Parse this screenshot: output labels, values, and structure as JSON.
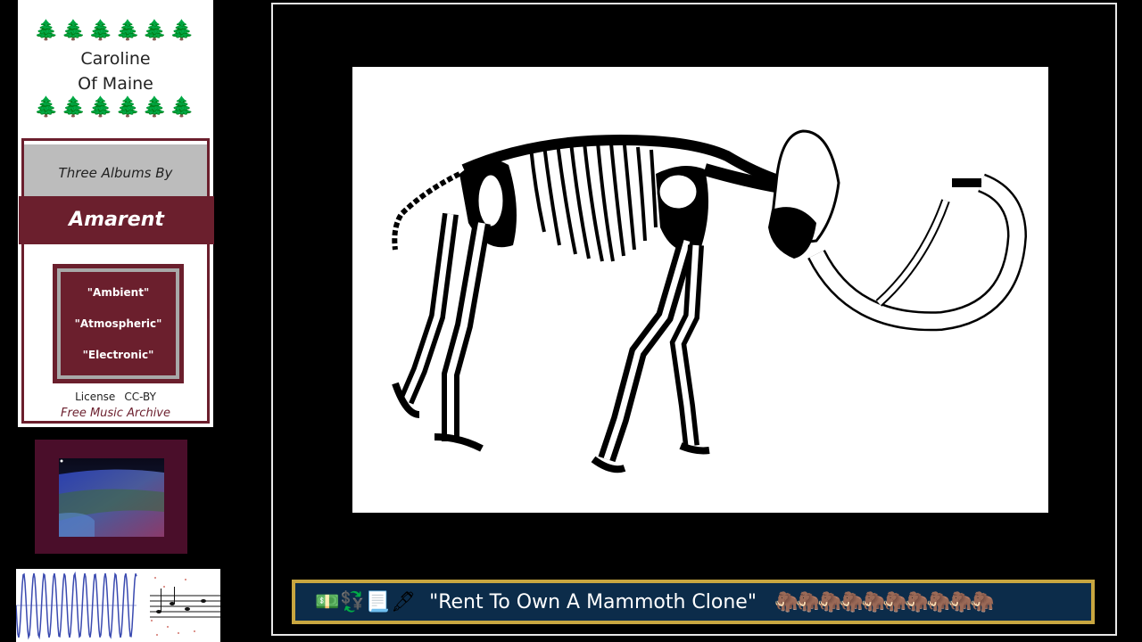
{
  "brand": {
    "trees": "🌲🌲🌲🌲🌲🌲",
    "name_line1": "Caroline",
    "name_line2": "Of Maine"
  },
  "album_panel": {
    "heading": "Three Albums By",
    "artist": "Amarent",
    "genres": [
      "\"Ambient\"",
      "\"Atmospheric\"",
      "\"Electronic\""
    ],
    "license_label": "License",
    "license_value": "CC-BY",
    "source": "Free Music Archive"
  },
  "caption": {
    "icons": "💵💱📃🖋",
    "title": "\"Rent To Own A Mammoth Clone\"",
    "mammoths": "🦣🦣🦣🦣🦣🦣🦣🦣🦣🦣"
  },
  "colors": {
    "maroon": "#6b1f2d",
    "caption_bg": "#0c2c4a",
    "caption_border": "#c8a640",
    "heading_gray": "#bcbcbc"
  }
}
